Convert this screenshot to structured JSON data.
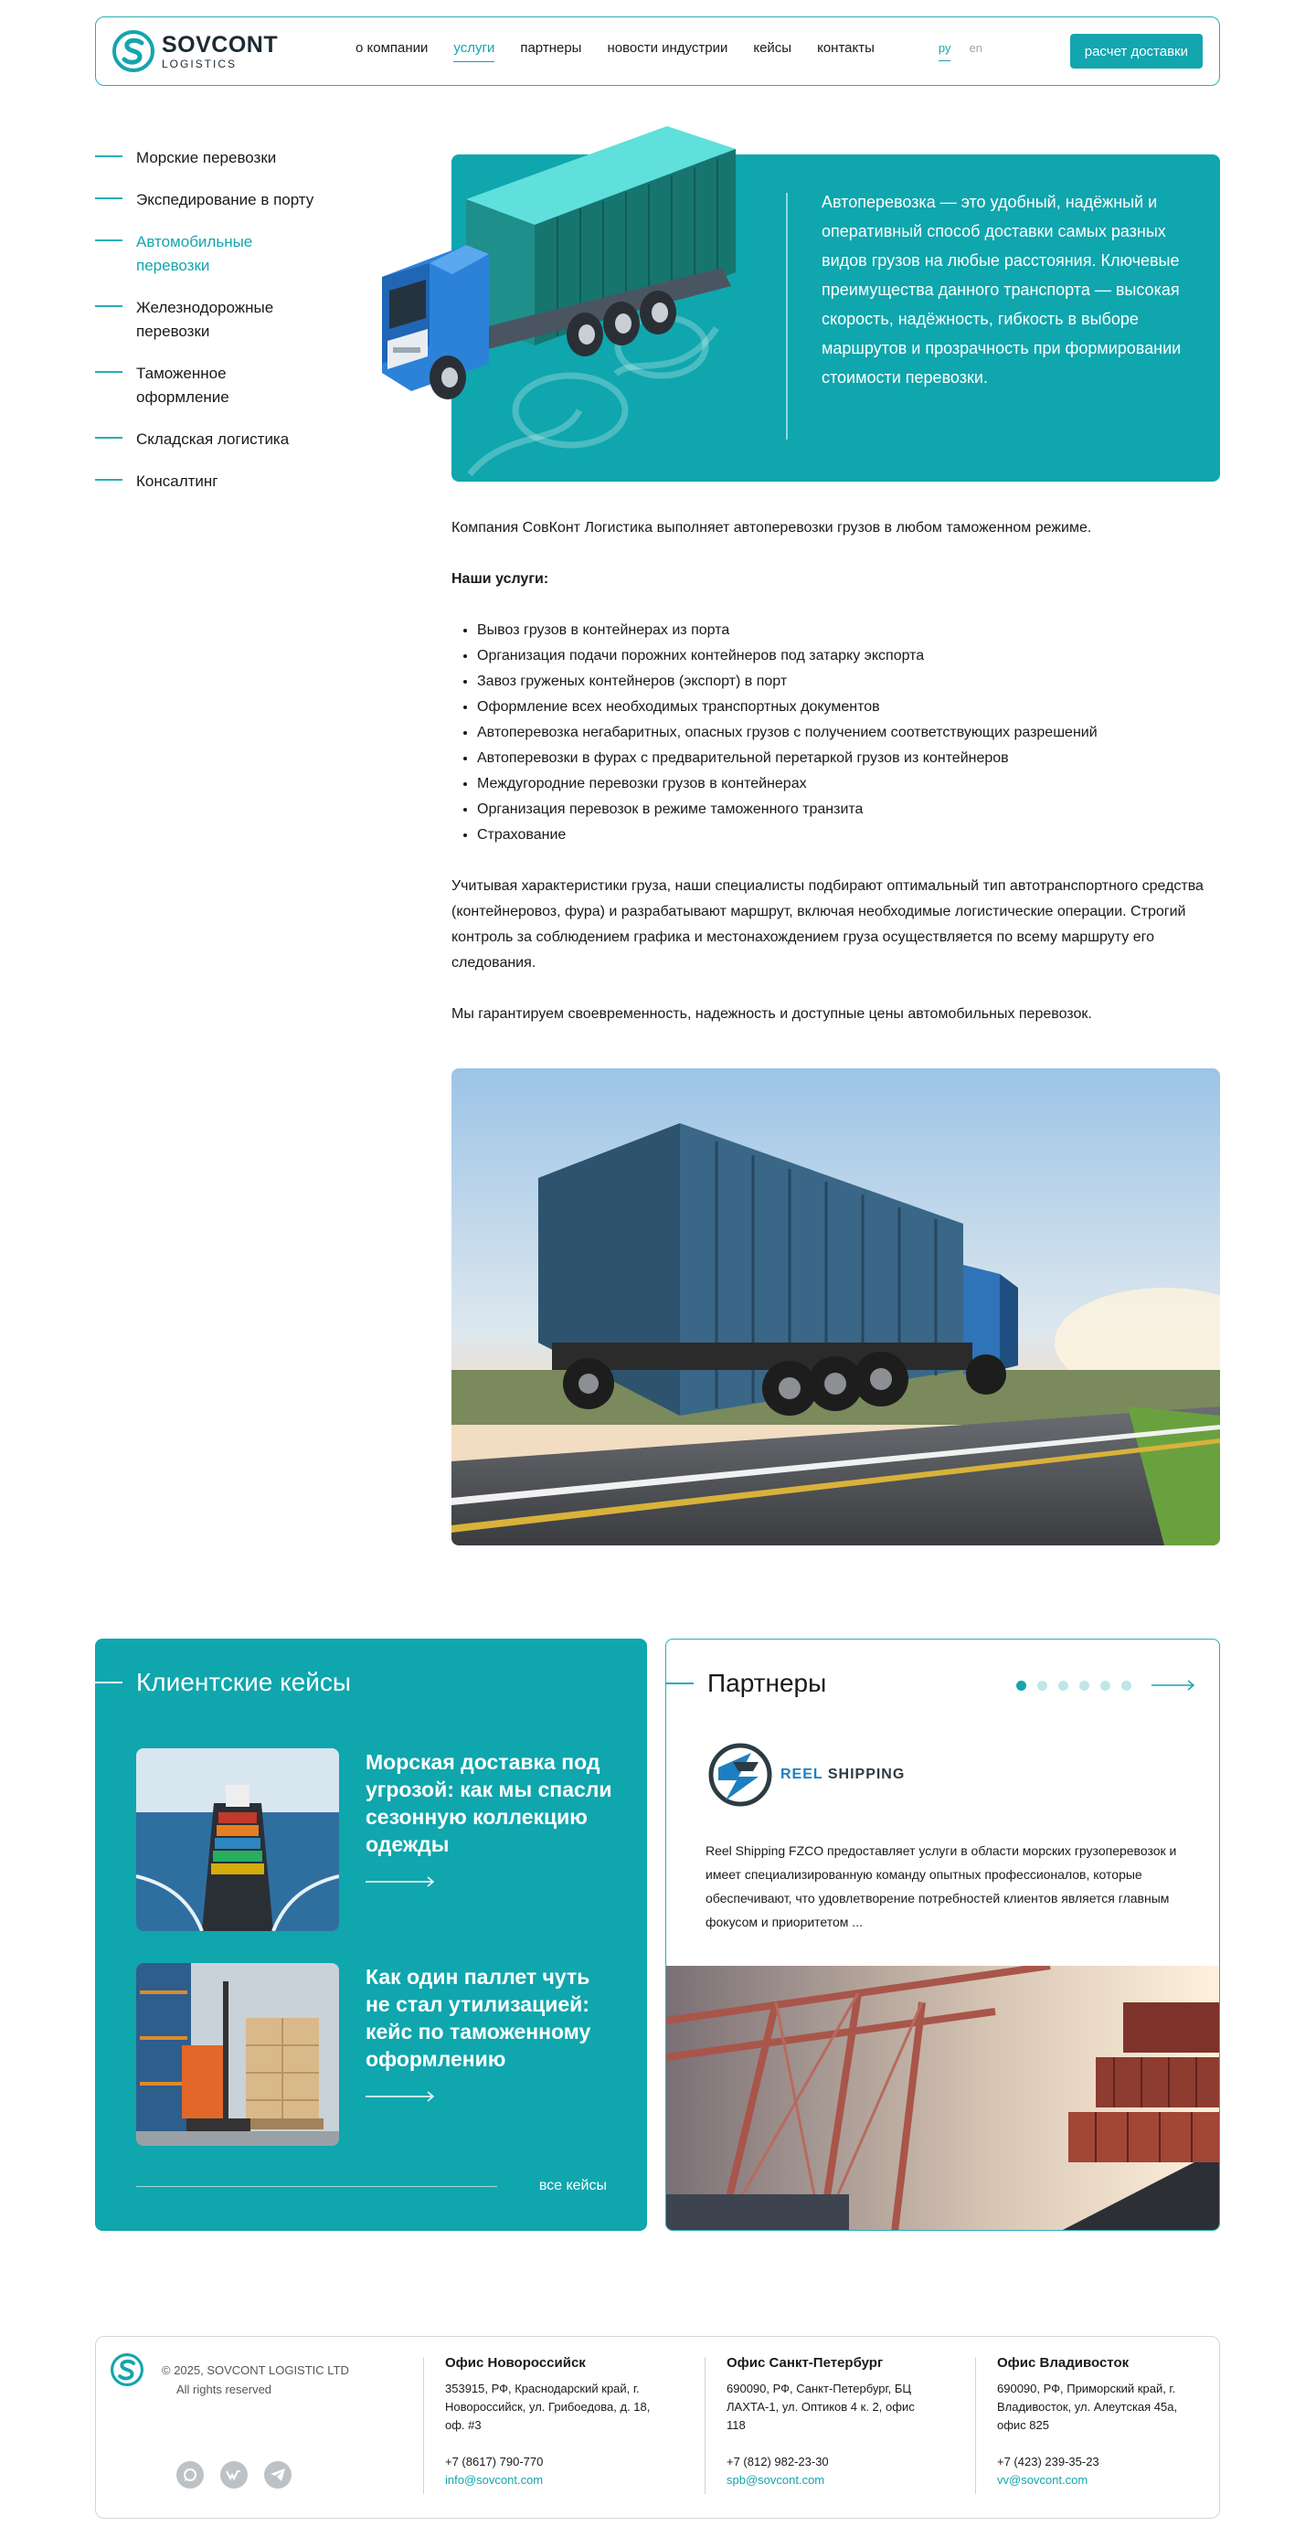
{
  "header": {
    "logo_name": "SOVCONT",
    "logo_sub": "LOGISTICS",
    "nav": [
      {
        "label": "о компании",
        "active": false
      },
      {
        "label": "услуги",
        "active": true
      },
      {
        "label": "партнеры",
        "active": false
      },
      {
        "label": "новости индустрии",
        "active": false
      },
      {
        "label": "кейсы",
        "active": false
      },
      {
        "label": "контакты",
        "active": false
      }
    ],
    "lang": [
      {
        "label": "ру",
        "active": true
      },
      {
        "label": "en",
        "active": false
      }
    ],
    "cta_label": "расчет доставки"
  },
  "sidebar": {
    "items": [
      {
        "label": "Морские перевозки",
        "active": false
      },
      {
        "label": "Экспедирование в порту",
        "active": false
      },
      {
        "label": "Автомобильные перевозки",
        "active": true
      },
      {
        "label": "Железнодорожные перевозки",
        "active": false
      },
      {
        "label": "Таможенное оформление",
        "active": false
      },
      {
        "label": "Складская логистика",
        "active": false
      },
      {
        "label": "Консалтинг",
        "active": false
      }
    ]
  },
  "hero": {
    "text": "Автоперевозка — это удобный, надёжный и оперативный способ доставки самых разных видов грузов на любые расстояния. Ключевые преимущества данного транспорта — высокая скорость, надёжность, гибкость в выборе маршрутов и прозрачность при формировании стоимости перевозки."
  },
  "content": {
    "intro": "Компания СовКонт Логистика выполняет автоперевозки грузов в любом таможенном режиме.",
    "services_heading": "Наши услуги:",
    "services": [
      "Вывоз грузов в контейнерах из порта",
      "Организация подачи порожних контейнеров под затарку экспорта",
      "Завоз груженых контейнеров (экспорт) в порт",
      "Оформление всех необходимых транспортных документов",
      "Автоперевозка негабаритных, опасных грузов с получением соответствующих разрешений",
      "Автоперевозки в фурах с предварительной перетаркой грузов из контейнеров",
      "Междугородние перевозки грузов в контейнерах",
      "Организация перевозок в режиме таможенного транзита",
      "Страхование"
    ],
    "paragraph": "Учитывая характеристики груза, наши специалисты подбирают оптимальный тип автотранспортного средства (контейнеровоз, фура) и разрабатывают маршрут, включая необходимые логистические операции. Строгий контроль за соблюдением графика и местонахождением груза осуществляется по всему маршруту его следования.",
    "guarantee": "Мы гарантируем своевременность, надежность и доступные цены автомобильных перевозок."
  },
  "cases": {
    "title": "Клиентские кейсы",
    "items": [
      {
        "title": "Морская доставка под угрозой: как мы спасли сезонную коллекцию одежды"
      },
      {
        "title": "Как один паллет чуть не стал утилизацией: кейс по таможенному оформлению"
      }
    ],
    "all_label": "все кейсы"
  },
  "partners": {
    "title": "Партнеры",
    "dots_total": 6,
    "dots_active": 1,
    "logo_word1": "REEL",
    "logo_word2": "SHIPPING",
    "description": "Reel Shipping FZCO предоставляет услуги в области морских грузоперевозок и имеет специализированную команду опытных профессионалов, которые обеспечивают, что удовлетворение потребностей клиентов является главным фокусом и приоритетом ..."
  },
  "footer": {
    "copyright": "© 2025, SOVCONT LOGISTIC LTD",
    "rights": "All rights reserved",
    "socials": [
      "whatsapp-icon",
      "vk-icon",
      "telegram-icon"
    ],
    "offices": [
      {
        "title": "Офис Новороссийск",
        "address": "353915, РФ, Краснодарский край, г. Новороссийск, ул. Грибоедова, д. 18, оф. #3",
        "phone": "+7 (8617) 790-770",
        "email": "info@sovcont.com"
      },
      {
        "title": "Офис Санкт-Петербург",
        "address": "690090, РФ, Санкт-Петербург, БЦ ЛАХТА-1, ул. Оптиков 4 к. 2, офис 118",
        "phone": "+7 (812) 982-23-30",
        "email": "spb@sovcont.com"
      },
      {
        "title": "Офис Владивосток",
        "address": "690090, РФ, Приморский край, г. Владивосток, ул. Алеутская 45а, офис 825",
        "phone": "+7 (423) 239-35-23",
        "email": "vv@sovcont.com"
      }
    ]
  },
  "colors": {
    "accent": "#14a5ae",
    "accent_light": "#bfe6e9",
    "text": "#1a1a1a"
  }
}
